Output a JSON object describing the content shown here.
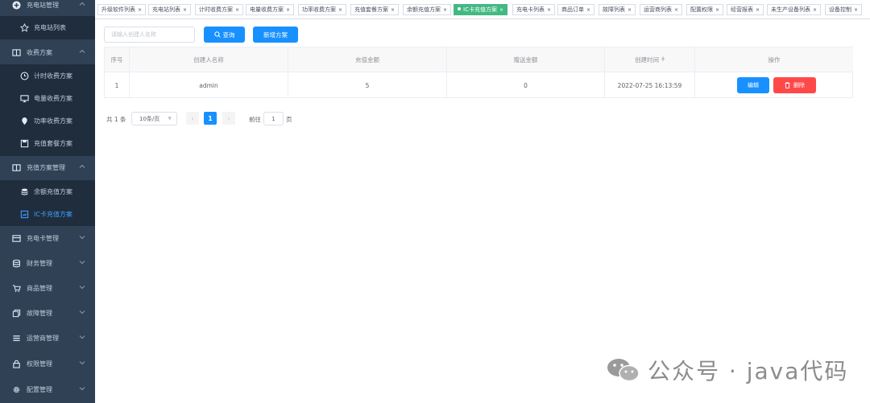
{
  "sidebar": {
    "items": [
      {
        "label": "充电站管理",
        "icon": "plus-circle-icon",
        "type": "group",
        "expanded": true
      },
      {
        "label": "充电站列表",
        "icon": "star-icon",
        "type": "sub"
      },
      {
        "label": "收费方案",
        "icon": "book-icon",
        "type": "group",
        "expanded": true
      },
      {
        "label": "计时收费方案",
        "icon": "clock-icon",
        "type": "sub"
      },
      {
        "label": "电量收费方案",
        "icon": "monitor-icon",
        "type": "sub"
      },
      {
        "label": "功率收费方案",
        "icon": "location-icon",
        "type": "sub"
      },
      {
        "label": "充值套餐方案",
        "icon": "save-icon",
        "type": "sub"
      },
      {
        "label": "充值方案管理",
        "icon": "book-icon",
        "type": "group",
        "expanded": true
      },
      {
        "label": "余额充值方案",
        "icon": "coins-icon",
        "type": "sub"
      },
      {
        "label": "IC卡充值方案",
        "icon": "card-chart-icon",
        "type": "sub",
        "active": true
      },
      {
        "label": "充电卡管理",
        "icon": "card-icon",
        "type": "group"
      },
      {
        "label": "财务管理",
        "icon": "database-icon",
        "type": "group"
      },
      {
        "label": "商品管理",
        "icon": "cart-icon",
        "type": "group"
      },
      {
        "label": "故障管理",
        "icon": "copy-icon",
        "type": "group"
      },
      {
        "label": "运营商管理",
        "icon": "list-icon",
        "type": "group"
      },
      {
        "label": "权限管理",
        "icon": "lock-icon",
        "type": "group"
      },
      {
        "label": "配置管理",
        "icon": "gear-icon",
        "type": "group"
      }
    ]
  },
  "tabs": [
    {
      "label": "升级软件列表"
    },
    {
      "label": "充电站列表"
    },
    {
      "label": "计时收费方案"
    },
    {
      "label": "电量收费方案"
    },
    {
      "label": "功率收费方案"
    },
    {
      "label": "充值套餐方案"
    },
    {
      "label": "余额充值方案"
    },
    {
      "label": "IC卡充值方案",
      "active": true
    },
    {
      "label": "充电卡列表"
    },
    {
      "label": "商品订单"
    },
    {
      "label": "故障列表"
    },
    {
      "label": "运营商列表"
    },
    {
      "label": "配置权限"
    },
    {
      "label": "经营报表"
    },
    {
      "label": "未生产设备列表"
    },
    {
      "label": "设备控制"
    }
  ],
  "toolbar": {
    "search_placeholder": "请输入创建人名称",
    "query_label": "查询",
    "add_label": "新增方案"
  },
  "table": {
    "headers": [
      "序号",
      "创建人名称",
      "充值金额",
      "赠送金额",
      "创建时间",
      "操作"
    ],
    "rows": [
      {
        "index": "1",
        "creator": "admin",
        "amount": "5",
        "bonus": "0",
        "created": "2022-07-25 16:13:59"
      }
    ],
    "edit_label": "编辑",
    "delete_label": "删除"
  },
  "pagination": {
    "total": "共 1 条",
    "page_size": "10条/页",
    "current_page": "1",
    "goto_prefix": "前往",
    "goto_value": "1",
    "goto_suffix": "页"
  },
  "watermark": {
    "text": "公众号 · java代码"
  },
  "colors": {
    "sidebar_bg": "#304156",
    "submenu_bg": "#1f2d3d",
    "primary": "#1890ff",
    "danger": "#ff4949",
    "active_tab": "#42b983"
  }
}
